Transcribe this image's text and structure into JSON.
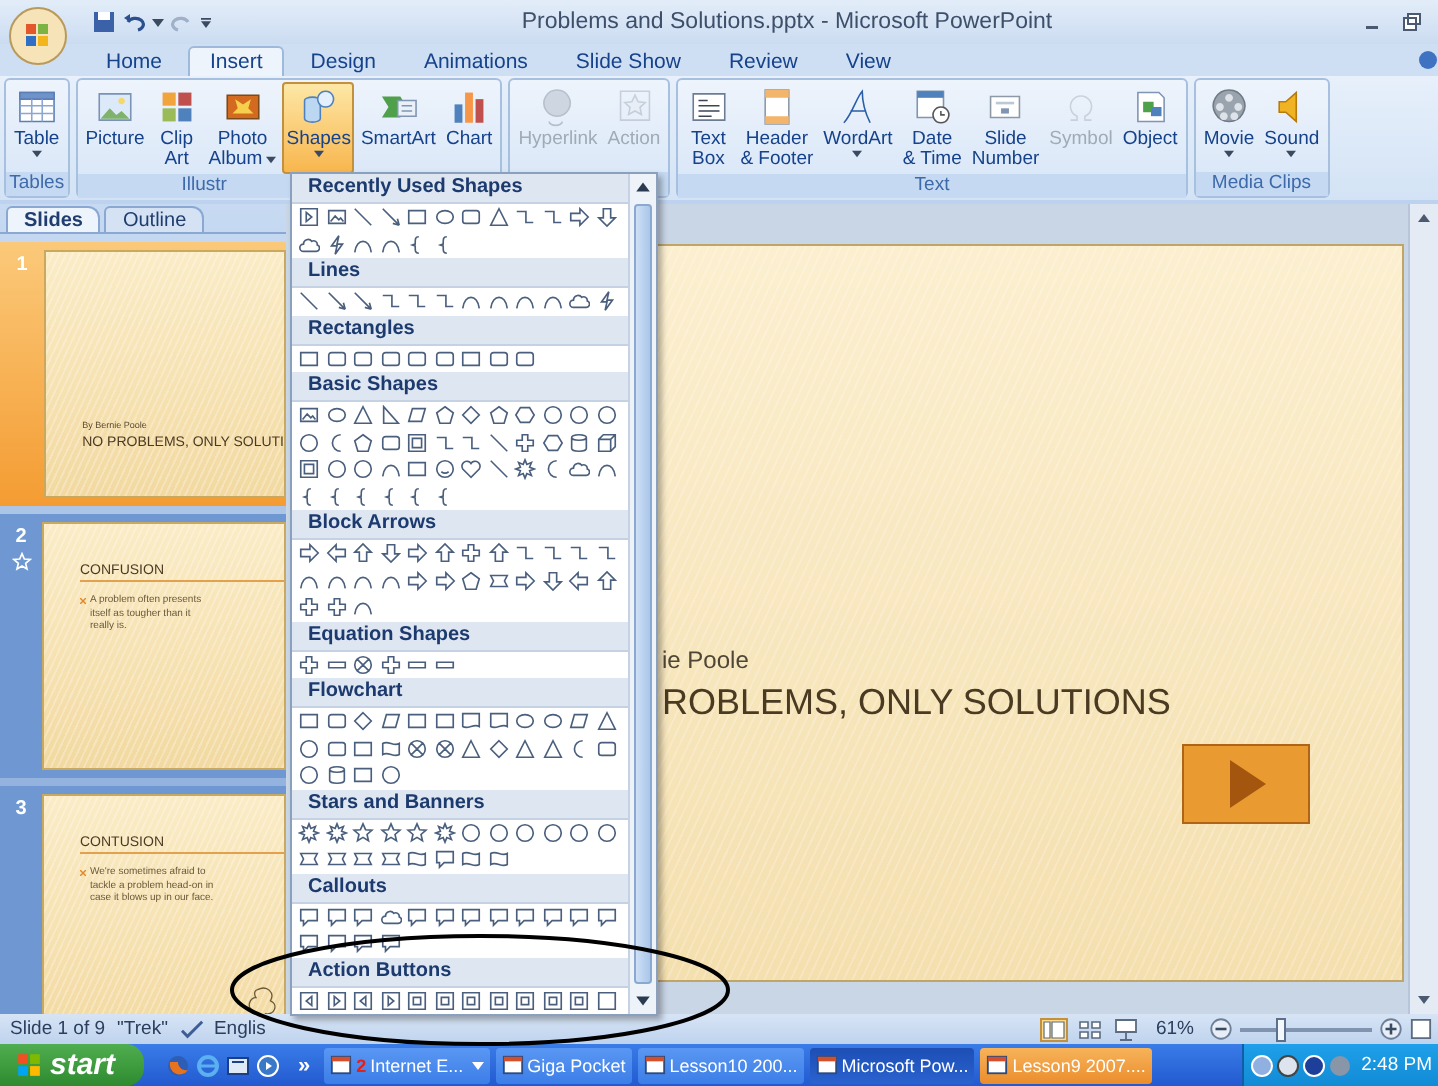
{
  "window": {
    "title": "Problems and Solutions.pptx - Microsoft PowerPoint"
  },
  "ribbon_tabs": [
    {
      "label": "Home",
      "selected": false
    },
    {
      "label": "Insert",
      "selected": true
    },
    {
      "label": "Design",
      "selected": false
    },
    {
      "label": "Animations",
      "selected": false
    },
    {
      "label": "Slide Show",
      "selected": false
    },
    {
      "label": "Review",
      "selected": false
    },
    {
      "label": "View",
      "selected": false
    }
  ],
  "ribbon_groups": [
    {
      "label": "Tables",
      "commands": [
        {
          "lines": [
            "Table"
          ],
          "dropdown": true,
          "disabled": false,
          "active": false
        }
      ]
    },
    {
      "label": "Illustr",
      "commands": [
        {
          "lines": [
            "Picture"
          ],
          "dropdown": false,
          "disabled": false,
          "active": false
        },
        {
          "lines": [
            "Clip",
            "Art"
          ],
          "dropdown": false,
          "disabled": false,
          "active": false
        },
        {
          "lines": [
            "Photo",
            "Album"
          ],
          "dropdown": true,
          "disabled": false,
          "active": false
        },
        {
          "lines": [
            "Shapes"
          ],
          "dropdown": true,
          "disabled": false,
          "active": true
        },
        {
          "lines": [
            "SmartArt"
          ],
          "dropdown": false,
          "disabled": false,
          "active": false
        },
        {
          "lines": [
            "Chart"
          ],
          "dropdown": false,
          "disabled": false,
          "active": false
        }
      ]
    },
    {
      "commands": [
        {
          "lines": [
            "Hyperlink"
          ],
          "dropdown": false,
          "disabled": true,
          "active": false
        },
        {
          "lines": [
            "Action"
          ],
          "dropdown": false,
          "disabled": true,
          "active": false
        }
      ]
    },
    {
      "label": "Text",
      "commands": [
        {
          "lines": [
            "Text",
            "Box"
          ],
          "dropdown": false,
          "disabled": false,
          "active": false
        },
        {
          "lines": [
            "Header",
            "& Footer"
          ],
          "dropdown": false,
          "disabled": false,
          "active": false
        },
        {
          "lines": [
            "WordArt"
          ],
          "dropdown": true,
          "disabled": false,
          "active": false
        },
        {
          "lines": [
            "Date",
            "& Time"
          ],
          "dropdown": false,
          "disabled": false,
          "active": false
        },
        {
          "lines": [
            "Slide",
            "Number"
          ],
          "dropdown": false,
          "disabled": false,
          "active": false
        },
        {
          "lines": [
            "Symbol"
          ],
          "dropdown": false,
          "disabled": true,
          "active": false
        },
        {
          "lines": [
            "Object"
          ],
          "dropdown": false,
          "disabled": false,
          "active": false
        }
      ]
    },
    {
      "label": "Media Clips",
      "commands": [
        {
          "lines": [
            "Movie"
          ],
          "dropdown": true,
          "disabled": false,
          "active": false
        },
        {
          "lines": [
            "Sound"
          ],
          "dropdown": true,
          "disabled": false,
          "active": false
        }
      ]
    }
  ],
  "shape_gallery": {
    "categories": [
      {
        "title": "Recently Used Shapes"
      },
      {
        "title": "Lines"
      },
      {
        "title": "Rectangles"
      },
      {
        "title": "Basic Shapes"
      },
      {
        "title": "Block Arrows"
      },
      {
        "title": "Equation Shapes"
      },
      {
        "title": "Flowchart"
      },
      {
        "title": "Stars and Banners"
      },
      {
        "title": "Callouts"
      },
      {
        "title": "Action Buttons"
      }
    ]
  },
  "panel_tabs": [
    {
      "label": "Slides",
      "selected": true
    },
    {
      "label": "Outline",
      "selected": false
    }
  ],
  "thumbnails": [
    {
      "number": "1",
      "kind": "title",
      "selected": true,
      "animated": false,
      "subtitle": "By Bernie Poole",
      "title": "NO PROBLEMS, ONLY SOLUTI"
    },
    {
      "number": "2",
      "kind": "content",
      "selected": false,
      "animated": true,
      "title": "CONFUSION",
      "bullet": "A problem often presents itself as tougher than it really is."
    },
    {
      "number": "3",
      "kind": "content",
      "selected": false,
      "animated": false,
      "title": "CONTUSION",
      "bullet": "We're sometimes afraid to tackle a problem head-on in case it blows up in our face."
    }
  ],
  "slide": {
    "subtitle": "ie Poole",
    "title": "ROBLEMS, ONLY SOLUTIONS"
  },
  "status_bar": {
    "slide": "Slide 1 of 9",
    "theme": "\"Trek\"",
    "language": "Englis",
    "zoom": "61%",
    "zoom_slider": {
      "level": 0.3
    }
  },
  "taskbar": {
    "start": "start",
    "more": "»",
    "tasks": [
      {
        "count": "2",
        "label": "Internet E...",
        "dropdown": true,
        "selected": false,
        "flashing": false
      },
      {
        "label": "Giga Pocket",
        "dropdown": false,
        "selected": false,
        "flashing": false
      },
      {
        "label": "Lesson10 200...",
        "dropdown": false,
        "selected": false,
        "flashing": false
      },
      {
        "label": "Microsoft Pow...",
        "dropdown": false,
        "selected": true,
        "flashing": false
      },
      {
        "label": "Lesson9 2007....",
        "dropdown": false,
        "selected": false,
        "flashing": true
      }
    ],
    "clock": "2:48 PM"
  }
}
